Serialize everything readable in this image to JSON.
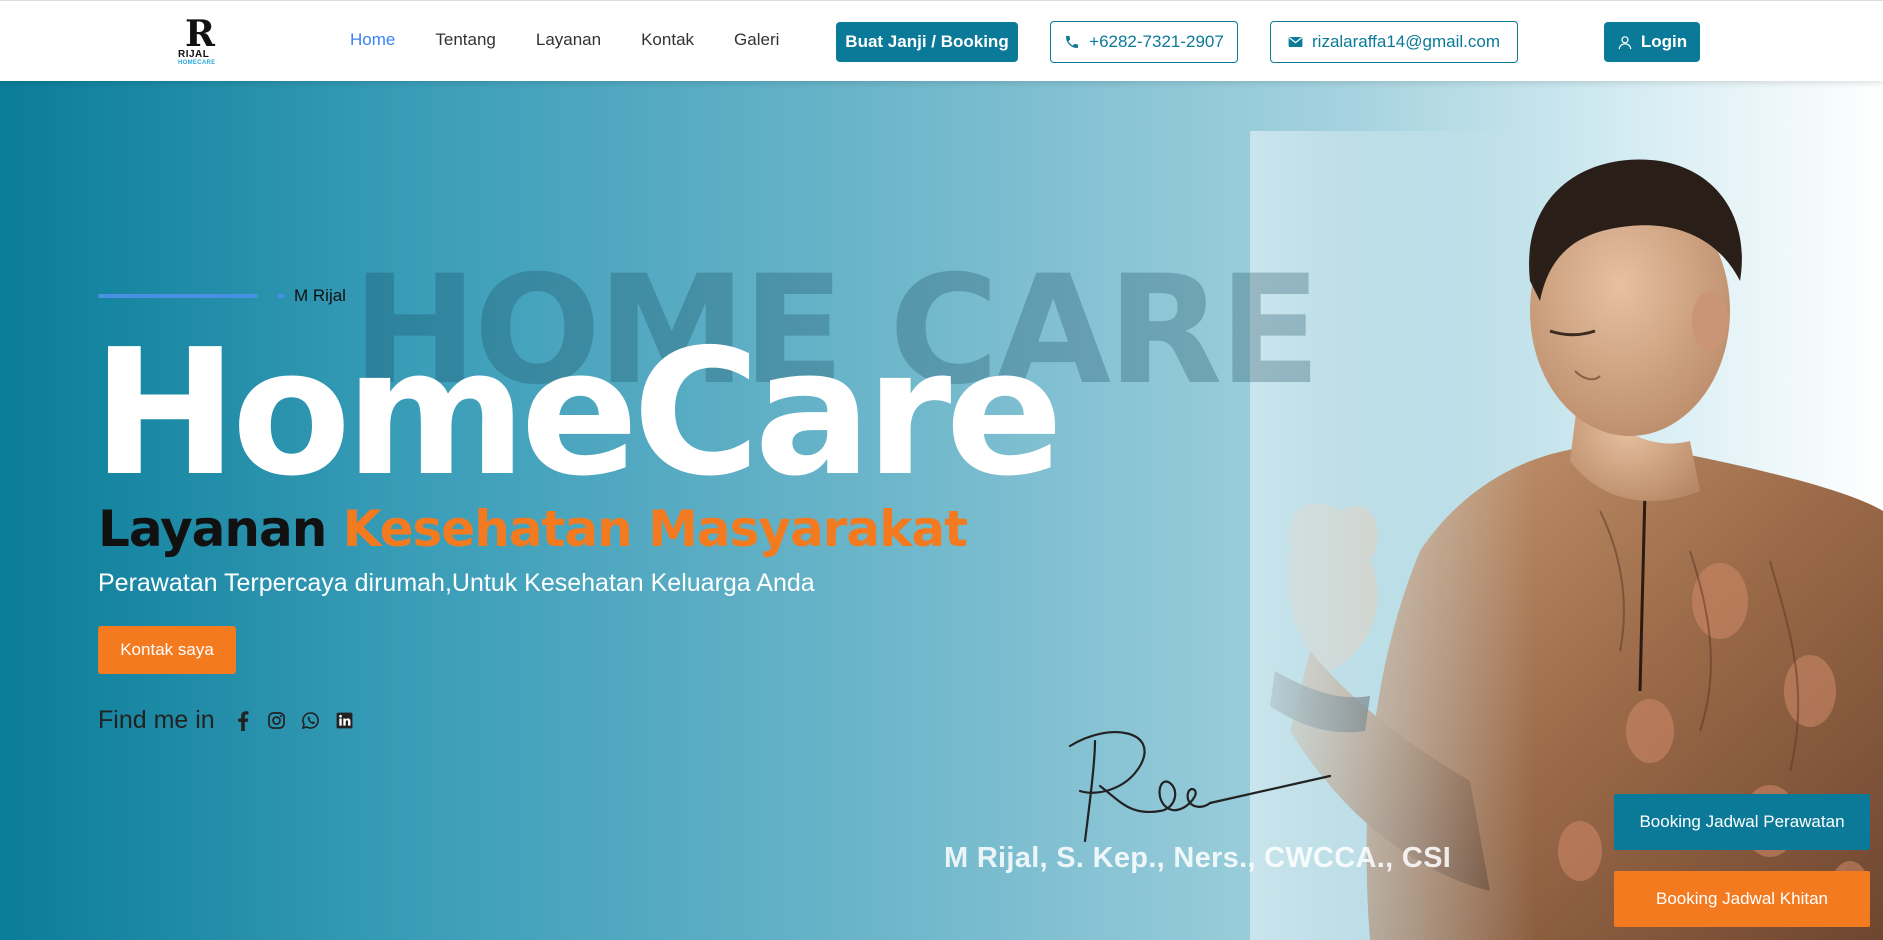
{
  "logo": {
    "mark": "R",
    "name": "RIJAL",
    "sub": "HOMECARE"
  },
  "nav": {
    "items": [
      {
        "label": "Home",
        "active": true
      },
      {
        "label": "Tentang",
        "active": false
      },
      {
        "label": "Layanan",
        "active": false
      },
      {
        "label": "Kontak",
        "active": false
      },
      {
        "label": "Galeri",
        "active": false
      }
    ]
  },
  "header": {
    "booking_label": "Buat Janji / Booking",
    "phone": "+6282-7321-2907",
    "email": "rizalaraffa14@gmail.com",
    "login_label": "Login",
    "icons": {
      "phone": "phone-icon",
      "email": "mail-icon",
      "login": "user-icon"
    }
  },
  "hero": {
    "watermark": "HOME CARE",
    "tag_name": "M Rijal",
    "title": "HomeCare",
    "subtitle_dark": "Layanan",
    "subtitle_orange": "Kesehatan Masyarakat",
    "tagline": "Perawatan Terpercaya dirumah,Untuk Kesehatan Keluarga Anda",
    "contact_button": "Kontak saya",
    "find_me_label": "Find me in",
    "socials": [
      "facebook-icon",
      "instagram-icon",
      "whatsapp-icon",
      "linkedin-icon"
    ],
    "signature_name": "M Rijal, S. Kep., Ners., CWCCA., CSI"
  },
  "floating_buttons": {
    "perawatan": "Booking Jadwal Perawatan",
    "khitan": "Booking Jadwal Khitan"
  },
  "colors": {
    "primary": "#0b7a98",
    "accent": "#f47a20",
    "nav_active": "#3b82f6",
    "tag_line": "#4a90e2"
  }
}
